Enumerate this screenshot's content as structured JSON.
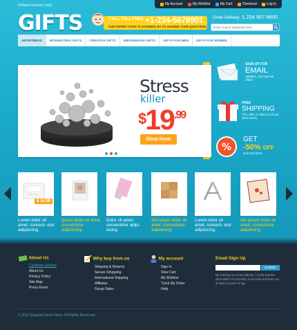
{
  "header": {
    "welcome": "Default welcome msg!",
    "logo": "GIFTS",
    "toll_label": "CALL TOLL FREE",
    "toll_number": "+1-234-5678901",
    "toll_sub": "OUR EXPERT STAFF IS STANDING BY TO ANSWER YOUR QUESTIONS",
    "order_label": "Order Delivery",
    "order_number": "1 234 567 8900",
    "search_placeholder": "Enter search keywords here"
  },
  "topnav": [
    {
      "label": "My Account",
      "color": "#f4c000"
    },
    {
      "label": "My Wishlist",
      "color": "#e05050"
    },
    {
      "label": "My Cart",
      "color": "#4aa0e0"
    },
    {
      "label": "Checkout",
      "color": "#f0a020"
    },
    {
      "label": "Log In",
      "color": "#f4c000"
    }
  ],
  "menu": [
    "ANTISTRESS",
    "INTERESTING GIFTS",
    "CREATIVE GIFTS",
    "INEXPENSIVE GIFTS",
    "GIFTS FOR MEN",
    "GIFTS FOR WOMEN"
  ],
  "banner": {
    "headline": "Stress",
    "subhead": "killer",
    "price_dollar": "$",
    "price_main": "19",
    "price_cents": ".99",
    "button": "Shop Now!",
    "dots": [
      "#2aa8d8",
      "#e04a2a",
      "#2aa8d8"
    ]
  },
  "promos": {
    "email_top": "SIGN UP FOR",
    "email_title": "EMAIL",
    "email_sub": "updates, and special offers",
    "ship_top": "FREE",
    "ship_title": "SHIPPING",
    "ship_sub": "This offer is valid on all our store items.",
    "off_top": "GET",
    "off_title": "-50%",
    "off_suffix": "OFF",
    "off_sub": "selected lines"
  },
  "products": [
    {
      "text": "Lorem dolor sit amet, consect- etur adipisicing.",
      "price": "$ 24.58",
      "color": "#ffffff"
    },
    {
      "text": "Ipsum dolor sit amet, consectetur adipisicing.",
      "color": "#ffd21f"
    },
    {
      "text": "Dolor sit amet, consectetur adipi- sicing.",
      "color": "#ffffff"
    },
    {
      "text": "Set ipsum dolor sit amet, consectetur adipisicing.",
      "color": "#ffd21f"
    },
    {
      "text": "Lorem dolor sit amet, consect- etur adipisicing.",
      "color": "#ffffff"
    },
    {
      "text": "Set ipsum dolor sit amet, consectetur adipisicing.",
      "color": "#ffd21f"
    }
  ],
  "footer": {
    "about": {
      "title": "About Us",
      "links": [
        "Customer Service",
        "About Us",
        "Privacy Policy",
        "Site Map",
        "Press Room"
      ]
    },
    "buy": {
      "title": "Why buy from us",
      "links": [
        "Shipping & Returns",
        "Secure Shopping",
        "International Shipping",
        "Affiliates",
        "Group Sales"
      ]
    },
    "account": {
      "title": "My account",
      "links": [
        "Sign In",
        "View Cart",
        "My Wishlist",
        "Track My Order",
        "Help"
      ]
    },
    "signup": {
      "title": "Email Sign Up",
      "button": "SUBMIT",
      "text": "By entering my email address, I certify that the information I'm providing is accurate and that I am at least 13 years of age."
    },
    "copyright": "© 2011 Magento Demo Store. All Rights Reserved."
  }
}
